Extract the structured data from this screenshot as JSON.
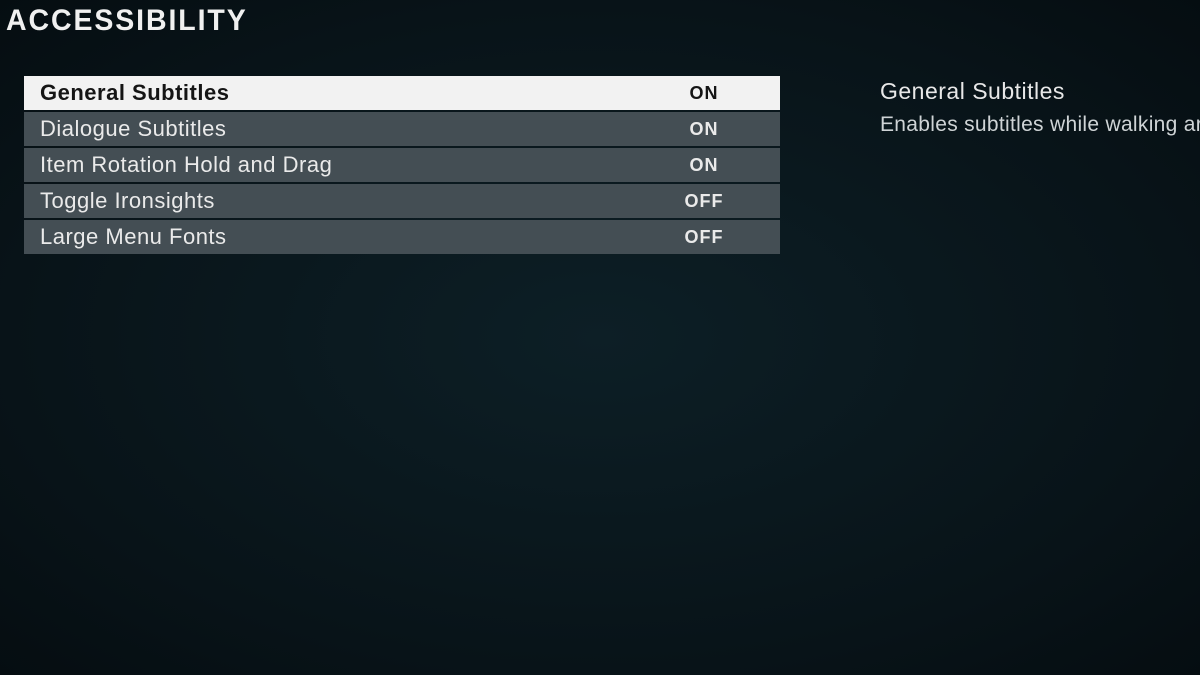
{
  "header": {
    "title": "ACCESSIBILITY"
  },
  "settings": [
    {
      "label": "General Subtitles",
      "value": "ON",
      "selected": true
    },
    {
      "label": "Dialogue Subtitles",
      "value": "ON",
      "selected": false
    },
    {
      "label": "Item Rotation Hold and Drag",
      "value": "ON",
      "selected": false
    },
    {
      "label": "Toggle Ironsights",
      "value": "OFF",
      "selected": false
    },
    {
      "label": "Large Menu Fonts",
      "value": "OFF",
      "selected": false
    }
  ],
  "detail": {
    "title": "General Subtitles",
    "description": "Enables subtitles while walking aro"
  }
}
